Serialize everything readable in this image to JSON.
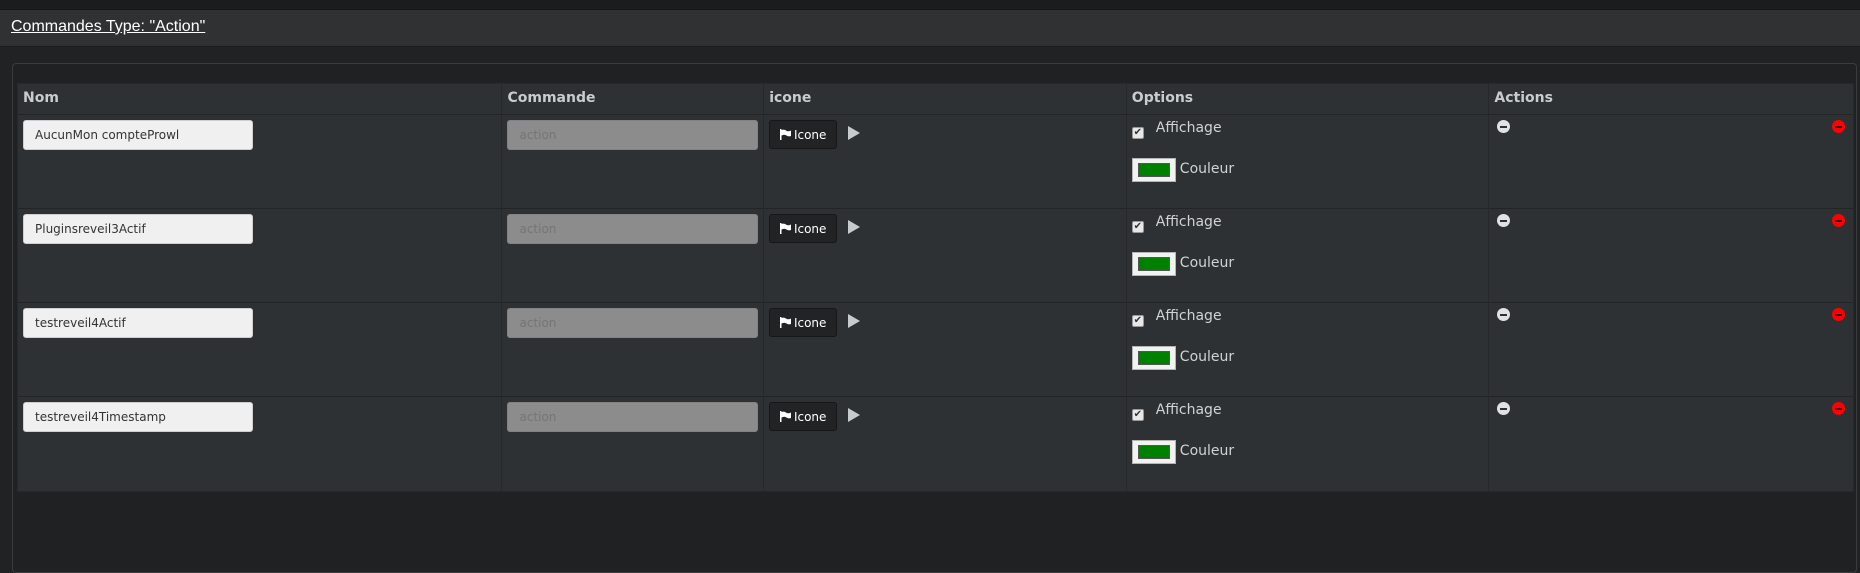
{
  "title": "Commandes Type: \"Action\"",
  "table": {
    "headers": [
      "Nom",
      "Commande",
      "icone",
      "Options",
      "Actions"
    ],
    "rows": [
      {
        "nom": "AucunMon compteProwl",
        "commande_placeholder": "action",
        "icon_button": "Icone",
        "affichage_label": "Affichage",
        "affichage_checked": true,
        "couleur_label": "Couleur",
        "couleur": "#008000"
      },
      {
        "nom": "Pluginsreveil3Actif",
        "commande_placeholder": "action",
        "icon_button": "Icone",
        "affichage_label": "Affichage",
        "affichage_checked": true,
        "couleur_label": "Couleur",
        "couleur": "#008000"
      },
      {
        "nom": "testreveil4Actif",
        "commande_placeholder": "action",
        "icon_button": "Icone",
        "affichage_label": "Affichage",
        "affichage_checked": true,
        "couleur_label": "Couleur",
        "couleur": "#008000"
      },
      {
        "nom": "testreveil4Timestamp",
        "commande_placeholder": "action",
        "icon_button": "Icone",
        "affichage_label": "Affichage",
        "affichage_checked": true,
        "couleur_label": "Couleur",
        "couleur": "#008000"
      }
    ]
  },
  "icons": {
    "icon_button": "flag-icon",
    "test": "play-icon",
    "move": "minus-circle-icon",
    "remove": "minus-circle-red-icon"
  },
  "colors": {
    "remove": "#ff0000",
    "swatch": "#008000"
  }
}
